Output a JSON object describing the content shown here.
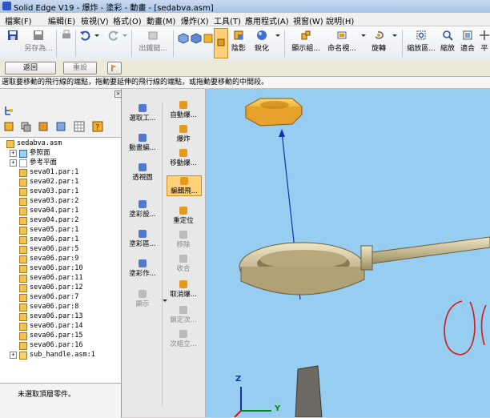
{
  "window": {
    "title": "Solid Edge V19 - 爆炸 - 塗彩 - 動畫 - [sedabva.asm]"
  },
  "menu": [
    "檔案(F)",
    "編輯(E)",
    "檢視(V)",
    "格式(O)",
    "動畫(M)",
    "爆炸(X)",
    "工具(T)",
    "應用程式(A)",
    "視窗(W)",
    "說明(H)"
  ],
  "toolbar": {
    "save_as": "另存為...",
    "export": "出鐵鎚...",
    "shading": "陰影",
    "sharpen": "銳化",
    "display_components": "顯示組...",
    "name_view": "命名視...",
    "rotate": "旋轉",
    "zoom_area": "縮放區...",
    "zoom": "縮放",
    "fit": "適合",
    "pan": "平"
  },
  "cmdbar": {
    "back": "返回",
    "redo": "重設"
  },
  "prompt": "選取要移動的飛行線的端點，拖動要延伸的飛行線的端點，或拖動要移動的中間段。",
  "tree": {
    "root": "sedabva.asm",
    "nodes": [
      {
        "label": "參照面",
        "kind": "folder"
      },
      {
        "label": "參考平面",
        "kind": "plane"
      },
      {
        "label": "seva01.par:1",
        "kind": "part"
      },
      {
        "label": "seva02.par:1",
        "kind": "part"
      },
      {
        "label": "seva03.par:1",
        "kind": "part"
      },
      {
        "label": "seva03.par:2",
        "kind": "part"
      },
      {
        "label": "seva04.par:1",
        "kind": "part"
      },
      {
        "label": "seva04.par:2",
        "kind": "part"
      },
      {
        "label": "seva05.par:1",
        "kind": "part"
      },
      {
        "label": "seva06.par:1",
        "kind": "part"
      },
      {
        "label": "seva06.par:5",
        "kind": "part"
      },
      {
        "label": "seva06.par:9",
        "kind": "part"
      },
      {
        "label": "seva06.par:10",
        "kind": "part"
      },
      {
        "label": "seva06.par:11",
        "kind": "part"
      },
      {
        "label": "seva06.par:12",
        "kind": "part"
      },
      {
        "label": "seva06.par:7",
        "kind": "part"
      },
      {
        "label": "seva06.par:8",
        "kind": "part"
      },
      {
        "label": "seva06.par:13",
        "kind": "part"
      },
      {
        "label": "seva06.par:14",
        "kind": "part"
      },
      {
        "label": "seva06.par:15",
        "kind": "part"
      },
      {
        "label": "seva06.par:16",
        "kind": "part"
      },
      {
        "label": "sub_handle.asm:1",
        "kind": "assembly"
      }
    ]
  },
  "status_box": "未選取頂層零件。",
  "tools_left": [
    {
      "label": "選取工...",
      "icon": "arrow-select-icon"
    },
    {
      "label": "動畫編...",
      "icon": "animation-editor-icon"
    },
    {
      "label": "透視圖",
      "icon": "perspective-icon"
    },
    {
      "label": "塗彩設...",
      "icon": "render-settings-icon"
    },
    {
      "label": "塗彩區...",
      "icon": "render-area-icon"
    },
    {
      "label": "塗彩作...",
      "icon": "render-job-icon"
    },
    {
      "label": "顯示",
      "icon": "display-icon"
    }
  ],
  "tools_right": [
    {
      "label": "自動爆...",
      "icon": "auto-explode-icon"
    },
    {
      "label": "爆炸",
      "icon": "explode-icon"
    },
    {
      "label": "移動爆...",
      "icon": "move-explode-icon"
    },
    {
      "label": "編輯飛...",
      "icon": "edit-flyline-icon",
      "selected": true
    },
    {
      "label": "重定位",
      "icon": "reposition-icon"
    },
    {
      "label": "移除",
      "icon": "remove-icon",
      "disabled": true
    },
    {
      "label": "收合",
      "icon": "collapse-icon",
      "disabled": true
    },
    {
      "label": "取消爆...",
      "icon": "unexplode-icon"
    },
    {
      "label": "鎖定次...",
      "icon": "lock-sub-icon",
      "disabled": true
    },
    {
      "label": "次組立...",
      "icon": "sub-assembly-icon",
      "disabled": true
    }
  ],
  "axes": {
    "z": "Z",
    "y": "Y"
  },
  "colors": {
    "viewport_bg": "#96cdf0",
    "part_gold": "#f2b233",
    "part_metal": "#d6c9a0",
    "flyline": "#1a2db0",
    "markup_red": "#d11a1a"
  }
}
